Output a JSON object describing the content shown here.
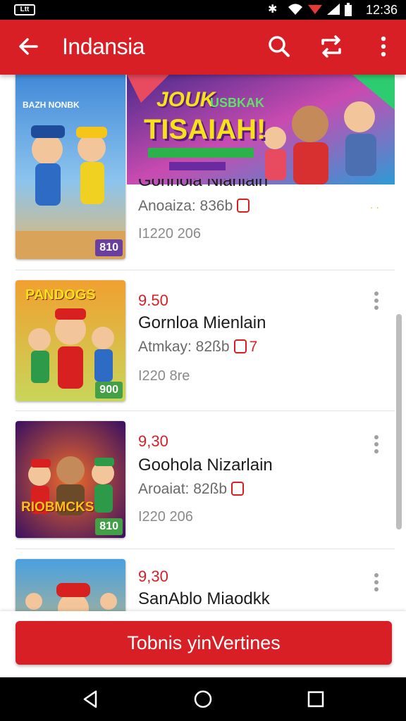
{
  "status_bar": {
    "left_badge": "Ltt",
    "time": "12:36"
  },
  "app_bar": {
    "title": "Indansia"
  },
  "items": [
    {
      "price": "",
      "name": "Gonhola Nianlain",
      "meta": "Anoaiza: 836b",
      "meta_num": "",
      "date": "I1220 206",
      "thumb_title": "BAZH NONBK",
      "thumb_tag": "810",
      "banner_line1": "JOUK",
      "banner_line2": "TISAIAH!",
      "banner_badge": "USBKAK"
    },
    {
      "price": "9.50",
      "name": "Gornloa Mienlain",
      "meta": "Atmkay: 82ßb",
      "meta_num": "7",
      "date": "I220 8re",
      "thumb_title": "PANDOGS",
      "thumb_tag": "900"
    },
    {
      "price": "9,30",
      "name": "Goohola Nizarlain",
      "meta": "Aroaiat: 82ßb",
      "meta_num": "",
      "date": "I220 206",
      "thumb_title": "RIOBMCKS",
      "thumb_tag": "810"
    },
    {
      "price": "9,30",
      "name": "SanAblo Miaodkk",
      "meta": "",
      "meta_num": "",
      "date": "",
      "thumb_title": "",
      "thumb_tag": ""
    }
  ],
  "cta": {
    "label": "Tobnis yinVertines"
  },
  "colors": {
    "brand_red": "#d81f26",
    "tag_purple": "#6b3fa0",
    "tag_green": "#43a047"
  },
  "icons": [
    "back-arrow-icon",
    "search-icon",
    "repeat-icon",
    "more-vert-icon",
    "kebab-icon",
    "nav-back-icon",
    "nav-home-icon",
    "nav-recents-icon"
  ]
}
